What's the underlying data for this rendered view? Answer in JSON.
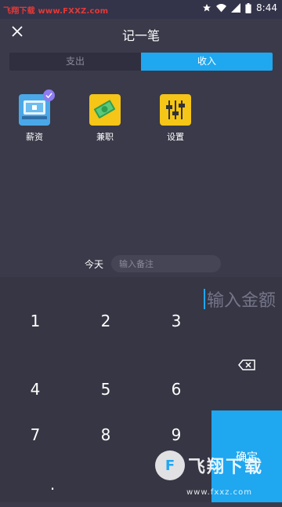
{
  "status": {
    "watermark": "飞翔下载 www.FXXZ.com",
    "time": "8:44"
  },
  "header": {
    "title": "记一笔"
  },
  "tabs": [
    {
      "label": "支出"
    },
    {
      "label": "收入"
    }
  ],
  "categories": [
    {
      "label": "薪资",
      "icon": "salary-icon",
      "selected": true
    },
    {
      "label": "兼职",
      "icon": "money-icon",
      "selected": false
    },
    {
      "label": "设置",
      "icon": "settings-icon",
      "selected": false
    }
  ],
  "notes": {
    "date_label": "今天",
    "placeholder": "输入备注"
  },
  "amount": {
    "placeholder": "输入金额"
  },
  "keypad": {
    "keys": [
      "1",
      "2",
      "3",
      "4",
      "5",
      "6",
      "7",
      "8",
      "9",
      "."
    ],
    "confirm_label": "确定"
  },
  "watermark": {
    "logo_text": "飞翔下载",
    "url": "www.fxxz.com"
  },
  "colors": {
    "accent": "#1fa7f0",
    "background": "#3a3a4a",
    "keypad_bg": "#363644"
  }
}
